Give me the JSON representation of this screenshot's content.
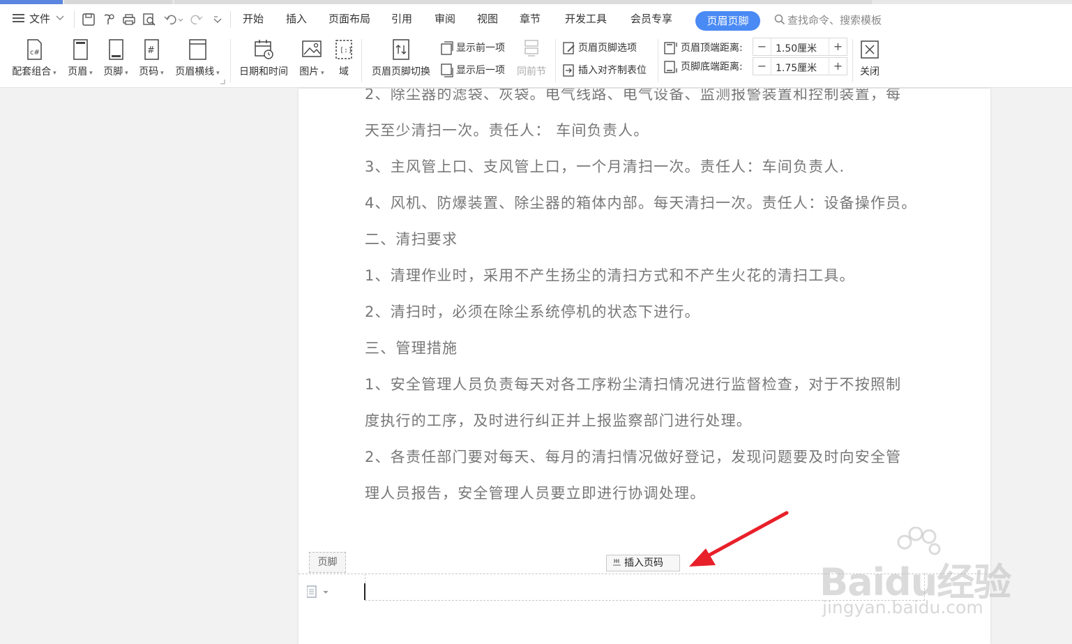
{
  "menu": {
    "file": "文件",
    "tabs": [
      "开始",
      "插入",
      "页面布局",
      "引用",
      "审阅",
      "视图",
      "章节",
      "开发工具",
      "会员专享"
    ],
    "active_tab": "页眉页脚",
    "search_placeholder": "查找命令、搜索模板"
  },
  "ribbon": {
    "combo": "配套组合",
    "header": "页眉",
    "footer": "页脚",
    "page_number": "页码",
    "header_line": "页眉横线",
    "datetime": "日期和时间",
    "picture": "图片",
    "field": "域",
    "switch": "页眉页脚切换",
    "show_prev": "显示前一项",
    "show_next": "显示后一项",
    "same_as_prev": "同前节",
    "options": "页眉页脚选项",
    "insert_tab": "插入对齐制表位",
    "header_top_label": "页眉顶端距离:",
    "header_top_value": "1.50厘米",
    "footer_bottom_label": "页脚底端距离:",
    "footer_bottom_value": "1.75厘米",
    "close": "关闭"
  },
  "document": {
    "lines": [
      "2、除尘器的滤袋、灰袋。电气线路、电气设备、监测报警装置和控制装置，每",
      "天至少清扫一次。责任人： 车间负责人。",
      "3、主风管上口、支风管上口，一个月清扫一次。责任人：车间负责人.",
      "4、风机、防爆装置、除尘器的箱体内部。每天清扫一次。责任人：设备操作员。",
      "二、清扫要求",
      "1、清理作业时，采用不产生扬尘的清扫方式和不产生火花的清扫工具。",
      "2、清扫时，必须在除尘系统停机的状态下进行。",
      "三、管理措施",
      "1、安全管理人员负责每天对各工序粉尘清扫情况进行监督检查，对于不按照制",
      "度执行的工序，及时进行纠正并上报监察部门进行处理。",
      "2、各责任部门要对每天、每月的清扫情况做好登记，发现问题要及时向安全管",
      "理人员报告，安全管理人员要立即进行协调处理。"
    ],
    "footer_label": "页脚",
    "insert_page_number": "插入页码"
  },
  "watermark": {
    "main": "Baidu经验",
    "sub": "jingyan.baidu.com"
  },
  "colors": {
    "accent": "#4a8af4",
    "arrow": "#e8202a"
  }
}
